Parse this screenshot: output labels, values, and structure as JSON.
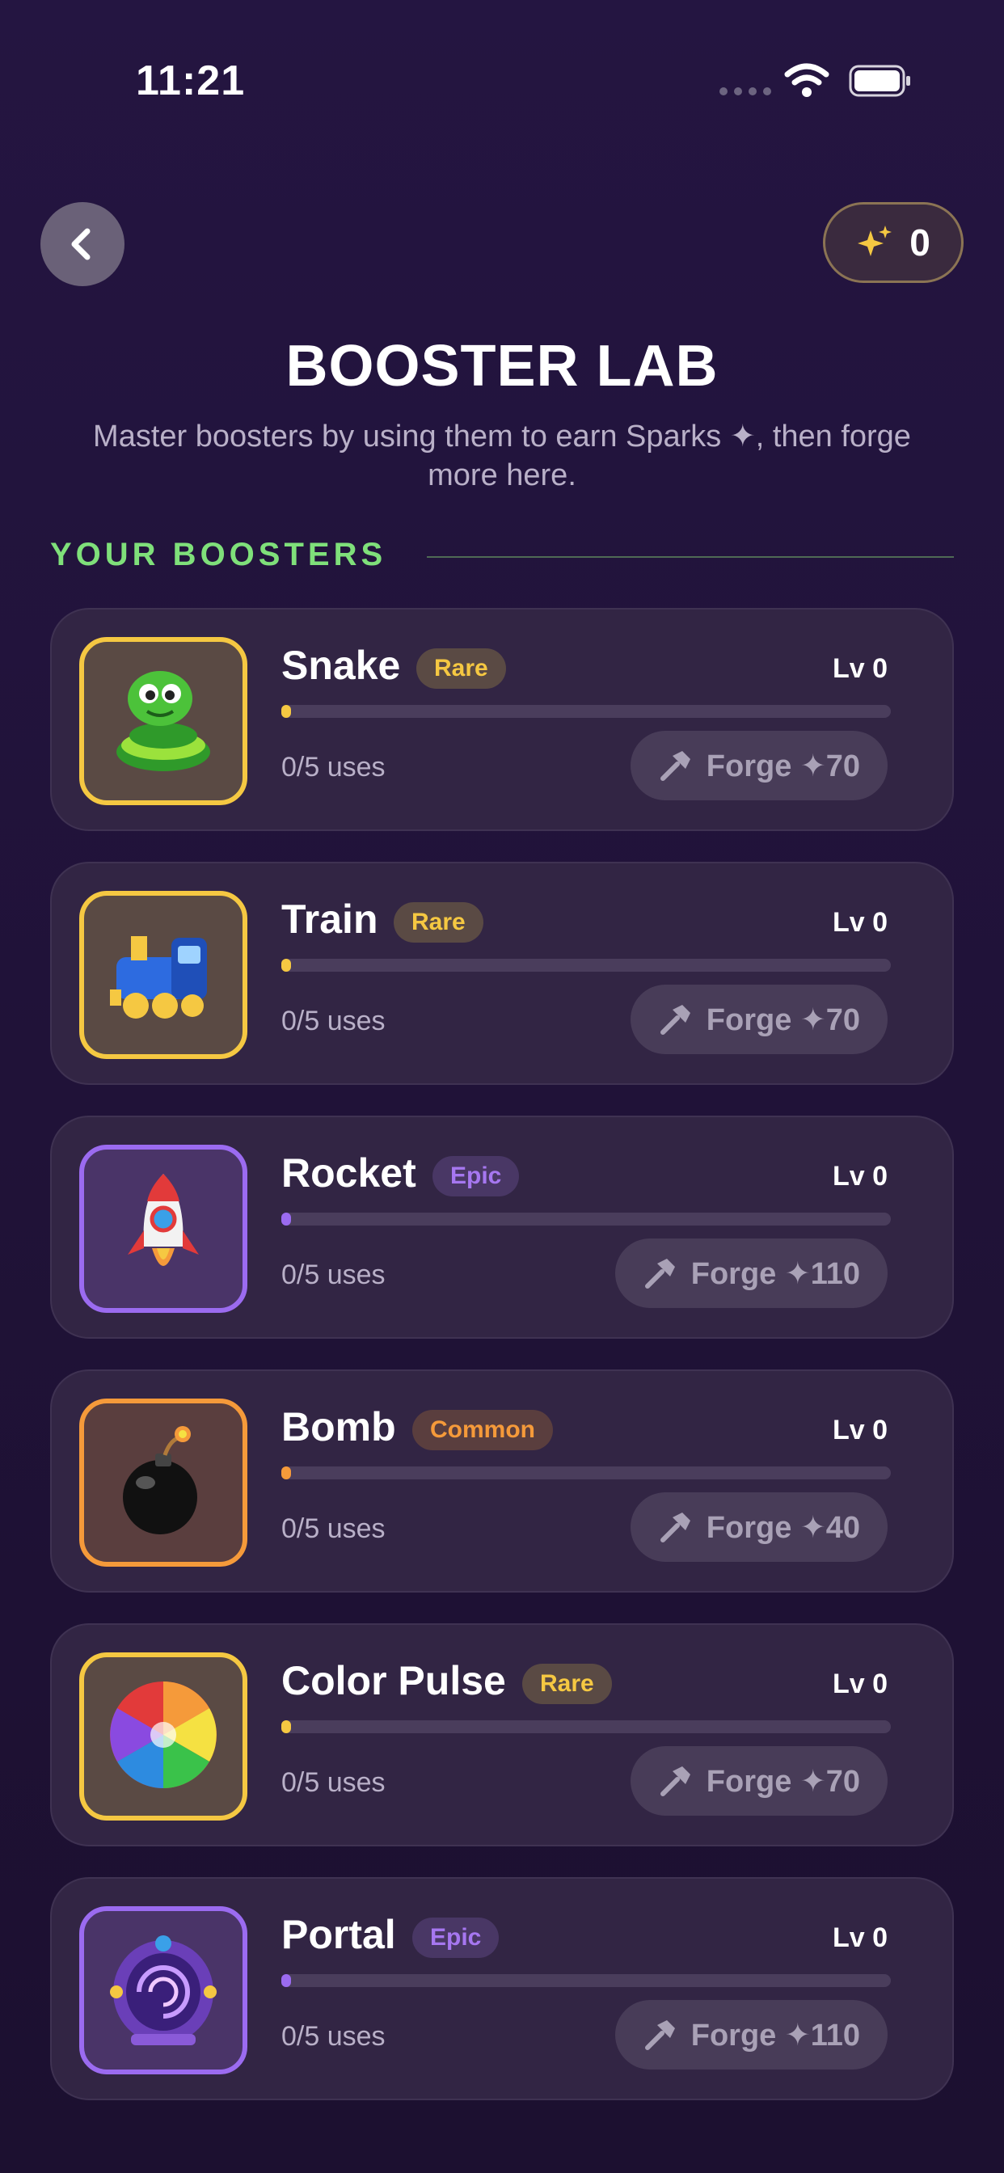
{
  "status_bar": {
    "time": "11:21"
  },
  "header": {
    "sparks_count": "0"
  },
  "title": "BOOSTER LAB",
  "subtitle": "Master boosters by using them to earn Sparks ✦, then forge more here.",
  "section_label": "YOUR BOOSTERS",
  "colors": {
    "rare": "#f5c842",
    "epic": "#9b6bf0",
    "common": "#f59a3a",
    "section": "#7fe07a"
  },
  "boosters": [
    {
      "name": "Snake",
      "rarity": "Rare",
      "level": "Lv 0",
      "uses": "0/5 uses",
      "forge": "Forge ✦70",
      "progress": 0,
      "icon": "snake-icon"
    },
    {
      "name": "Train",
      "rarity": "Rare",
      "level": "Lv 0",
      "uses": "0/5 uses",
      "forge": "Forge ✦70",
      "progress": 0,
      "icon": "train-icon"
    },
    {
      "name": "Rocket",
      "rarity": "Epic",
      "level": "Lv 0",
      "uses": "0/5 uses",
      "forge": "Forge ✦110",
      "progress": 0,
      "icon": "rocket-icon"
    },
    {
      "name": "Bomb",
      "rarity": "Common",
      "level": "Lv 0",
      "uses": "0/5 uses",
      "forge": "Forge ✦40",
      "progress": 0,
      "icon": "bomb-icon"
    },
    {
      "name": "Color Pulse",
      "rarity": "Rare",
      "level": "Lv 0",
      "uses": "0/5 uses",
      "forge": "Forge ✦70",
      "progress": 0,
      "icon": "color-pulse-icon"
    },
    {
      "name": "Portal",
      "rarity": "Epic",
      "level": "Lv 0",
      "uses": "0/5 uses",
      "forge": "Forge ✦110",
      "progress": 0,
      "icon": "portal-icon"
    }
  ]
}
